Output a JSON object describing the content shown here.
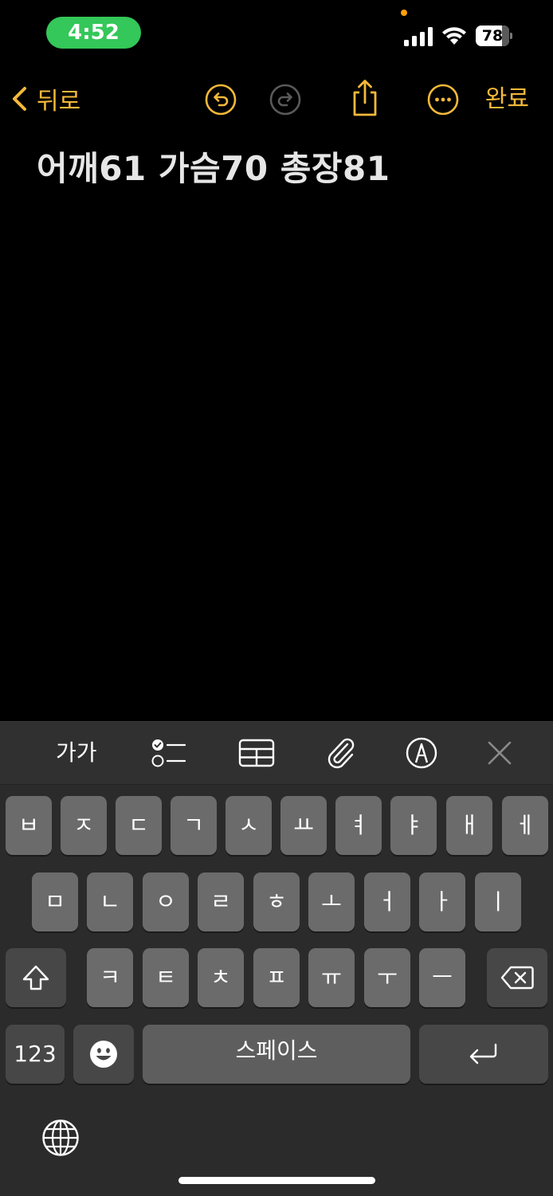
{
  "status_bar": {
    "time": "4:52",
    "battery": "78",
    "battery_level": 0.78,
    "accent_pill_color": "#34c759"
  },
  "toolbar": {
    "back_label": "뒤로",
    "done_label": "완료",
    "accent_color": "#f4b93a",
    "icons": [
      "chevron-left-icon",
      "undo-icon",
      "redo-icon",
      "share-icon",
      "more-icon"
    ]
  },
  "note": {
    "text": "어깨61 가슴70 총장81"
  },
  "accessory_bar": {
    "format_label": "가가",
    "icons": [
      "checklist-icon",
      "table-icon",
      "attachment-icon",
      "markup-icon",
      "close-icon"
    ]
  },
  "keyboard": {
    "row1": [
      "ㅂ",
      "ㅈ",
      "ㄷ",
      "ㄱ",
      "ㅅ",
      "ㅛ",
      "ㅕ",
      "ㅑ",
      "ㅐ",
      "ㅔ"
    ],
    "row2": [
      "ㅁ",
      "ㄴ",
      "ㅇ",
      "ㄹ",
      "ㅎ",
      "ㅗ",
      "ㅓ",
      "ㅏ",
      "ㅣ"
    ],
    "row3": [
      "ㅋ",
      "ㅌ",
      "ㅊ",
      "ㅍ",
      "ㅠ",
      "ㅜ",
      "ㅡ"
    ],
    "numbers_label": "123",
    "space_label": "스페이스"
  }
}
